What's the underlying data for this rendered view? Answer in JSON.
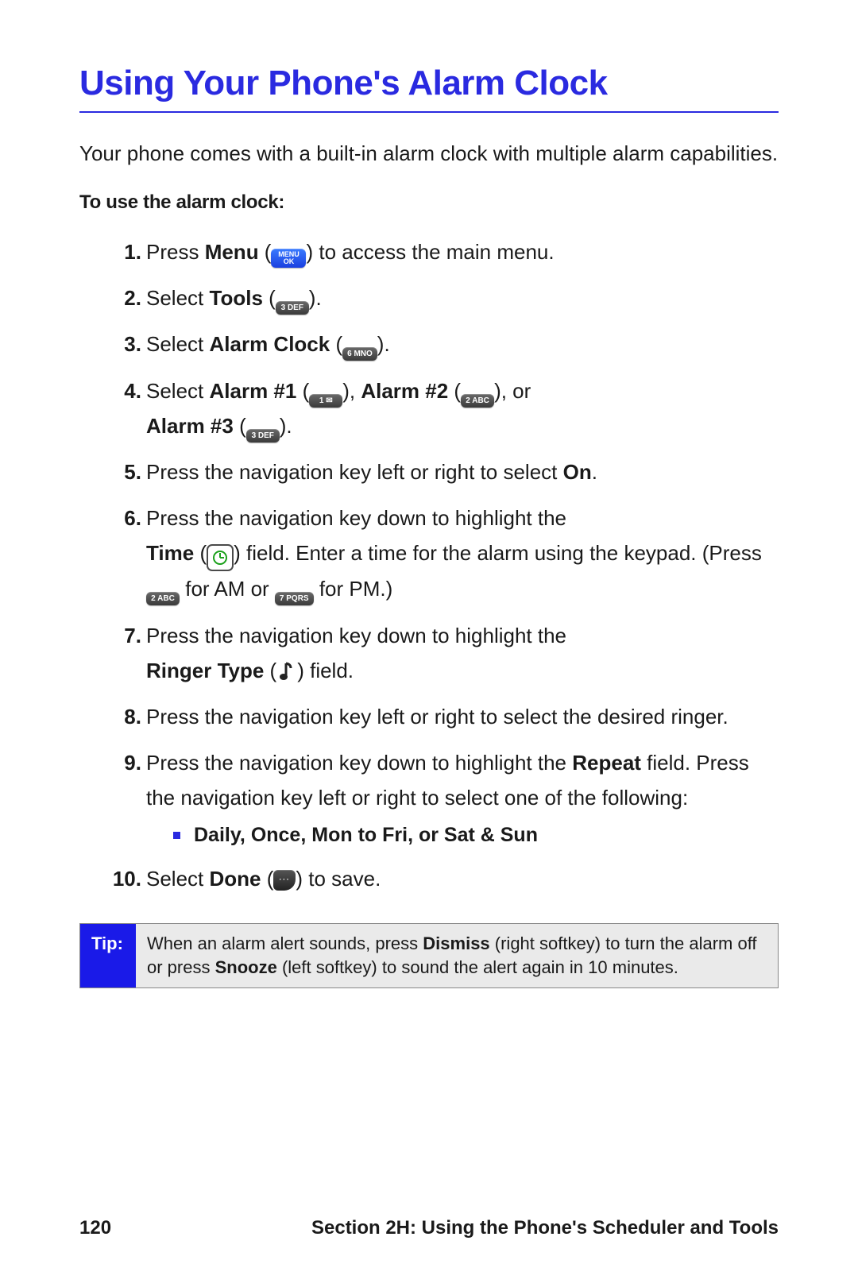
{
  "title": "Using Your Phone's Alarm Clock",
  "intro": "Your phone comes with a built-in alarm clock with multiple alarm capabilities.",
  "subhead": "To use the alarm clock:",
  "icons": {
    "menu_top": "MENU",
    "menu_bottom": "OK",
    "key3": "3 DEF",
    "key6": "6 MNO",
    "key1": "1 ✉",
    "key2": "2 ABC",
    "key7": "7 PQRS"
  },
  "steps": {
    "s1_a": "Press ",
    "s1_b": "Menu",
    "s1_c": " (",
    "s1_d": ") to access the main menu.",
    "s2_a": "Select ",
    "s2_b": "Tools",
    "s2_c": " (",
    "s2_d": ").",
    "s3_a": "Select ",
    "s3_b": "Alarm Clock",
    "s3_c": " (",
    "s3_d": ").",
    "s4_a": "Select ",
    "s4_b": "Alarm #1",
    "s4_c": " (",
    "s4_d": "), ",
    "s4_e": "Alarm #2",
    "s4_f": " (",
    "s4_g": "), or",
    "s4_h": "Alarm #3",
    "s4_i": " (",
    "s4_j": ").",
    "s5_a": "Press the navigation key left or right to select ",
    "s5_b": "On",
    "s5_c": ".",
    "s6_a": "Press the navigation key down to highlight the ",
    "s6_b": "Time",
    "s6_c": " (",
    "s6_d": ") field. Enter a time for the alarm using the keypad. (Press ",
    "s6_e": " for AM or ",
    "s6_f": " for PM.)",
    "s7_a": "Press the navigation key down to highlight the ",
    "s7_b": "Ringer Type",
    "s7_c": " (",
    "s7_d": ") field.",
    "s8": "Press the navigation key left or right to select the desired ringer.",
    "s9_a": "Press the navigation key down to highlight the ",
    "s9_b": "Repeat",
    "s9_c": " field. Press the navigation key left or right to select one of the following:",
    "s9_bullet_a": "Daily",
    "s9_bullet_b": "Once",
    "s9_bullet_c": "Mon to Fri",
    "s9_bullet_d": "Sat & Sun",
    "s9_bullet_sep": ", ",
    "s9_bullet_or": ", or ",
    "s10_a": "Select ",
    "s10_b": "Done",
    "s10_c": " (",
    "s10_d": ") to save."
  },
  "tip": {
    "label": "Tip:",
    "body_a": "When an alarm alert sounds, press ",
    "body_b": "Dismiss",
    "body_c": " (right softkey) to turn the alarm off or press ",
    "body_d": "Snooze",
    "body_e": " (left softkey) to sound the alert again in 10 minutes."
  },
  "footer": {
    "page": "120",
    "section": "Section 2H: Using the Phone's Scheduler and Tools"
  }
}
